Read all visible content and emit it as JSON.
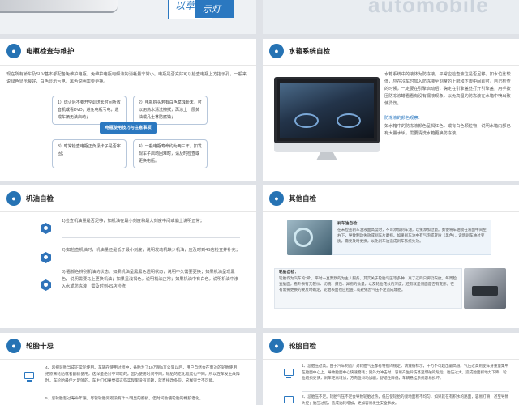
{
  "top_left": {
    "title_text": "以草的",
    "subtitle_text": "示灯"
  },
  "top_right": {
    "watermark": "automobile"
  },
  "s1": {
    "title": "电瓶检查与维护",
    "intro": "现在所有轿车及SUV基本都配备免维护电瓶，免维护电瓶电解液的消耗量非常小。电瓶是否充好可以检查电瓶上方指示孔，一般来说绿色显示良好，白色显示亏电，黑色说明需要更换。",
    "box1": "1）熄火后不要开空调送长时间听收音机或看DVD，避免电瓶亏电，造成车辆无法启动；",
    "box2": "2）电瓶桩头若有白色腐蚀粉末，可以用热水清洗擦拭，再涂上一层黄油或凡士林防腐蚀；",
    "box3": "3）时常检查电瓶正负极卡子是否牢固；",
    "box4": "4）一般电瓶寿命约为两三年，如发现车子启动困难时，请及时检查或更换电瓶。",
    "center": "电瓶使用技巧与注意事项"
  },
  "s2": {
    "title": "水箱系统自检",
    "para1": "水箱系统中的液体为防冻液，平常应检查液位是否足够，如水位比较低，应在冷车时加入防冻液至刻度的上限和下限中间即可。自己检查的时候，一定要在引擎启动后，确定在引擎盖处打开引擎盖，用手按压防冻液罐看看有没有漏液现象，以免高温的防冻液在水箱中喷出致使烫伤。",
    "highlight": "防冻液的颜色观察：",
    "para2": "如水箱中的防冻液颜色呈褐红色，或有白色颗粒物，说明水箱内部已有大量水垢，需要清洗水箱更换防冻液。"
  },
  "s3": {
    "title": "机油自检",
    "item1": "1)检查机油量是否足够，如机油在最小刻度和最大刻度中间或偏上说明正常；",
    "item2": "2) 如检查机油时，机油量还是低于最小刻度，说明发动机缺少机油，应及时到4S店检查并补充；",
    "item3": "3) 看颜色辨别机油的状态。如果机油呈黑黑色透明状态，说明不久需要更换；如果机油呈现黑色，说明需要马上更换机油；如果呈浅褐色，说明机油正常；如果机油中有白色，说明机油中渗入水或防冻液，需及时到4S店检修；"
  },
  "s4": {
    "title": "其他自检",
    "p1_title": "刹车油自检：",
    "p1_text": "在未检查刹车油液面高度时，不可添加刹车油，以免添加过量。勇便将车油锁在液面中间左右下，导致制动失效或刹车片磨损。如果刹车油中有气泡或变质（黑色），说明刹车油过变质，需要及时更换，以免刹车油造成刹车系统失效。",
    "p2_title": "轮胎自检：",
    "p2_text": "轮胎作为汽车的“脚”，平时一直默默的为主人服务，其实关于轮胎气压等多种，离了这四只脚仍安抗。每周检查胎面，看外表有无裂纹、切痕、鼓包、异物的数量，以及轮胎花纹的深度，还有就是侧面是否有变形，在有需要更换的要及时确定，轮胎表面也应检查...或避免因气压不足造成爆胎。"
  },
  "s5": {
    "title": "轮胎十忌",
    "item4": "4、忌把装胎当成正常轮使用。车辆在使用过程中，备胎为了10万到5万公里以后，用户自然会在面对的轮胎使用，把原来轮胎或者翻新使用，这样是绝对不可取的。因为使用时间不同，轮胎的老化程度也不同，所以在车发生故障时，车轮胎最佳才足够的，车主们如果觉得这些实现里没有问题，就直接改多些，这样完全不可能。",
    "item5": "5、忌轮胎超过寿命年限，尽管轮胎外观没有什么明显的磨损，但时间会使轮胎的橡胶老化。"
  },
  "s6": {
    "title": "轮胎自检",
    "item1": "1、忌胎压过高。由于汽车制造厂对轮胎气压都有特别的规定，请遵循标示，千万不可超出最高值。气压过高则使车身重量集中在胎面中心上，导致胎面中心快速磨耗；受外力冲击时，容易产生异伤甚至爆破的危险。胎压过大，造成胎面抓地力下降，轮胎磨损更快，刹车距离增加，方向盘抖动加剧，舒适性降低，车辆悬挂系统容易损坏。",
    "item2": "2、忌胎压不足。轮胎气压不足会导致轮胎过热，低压使轮胎的接地面积不均匀，如果就在有积水的路面，容易打滑，甚至导致失控；胎压过低，造成油耗增加，更加容易发生安全事故。"
  }
}
